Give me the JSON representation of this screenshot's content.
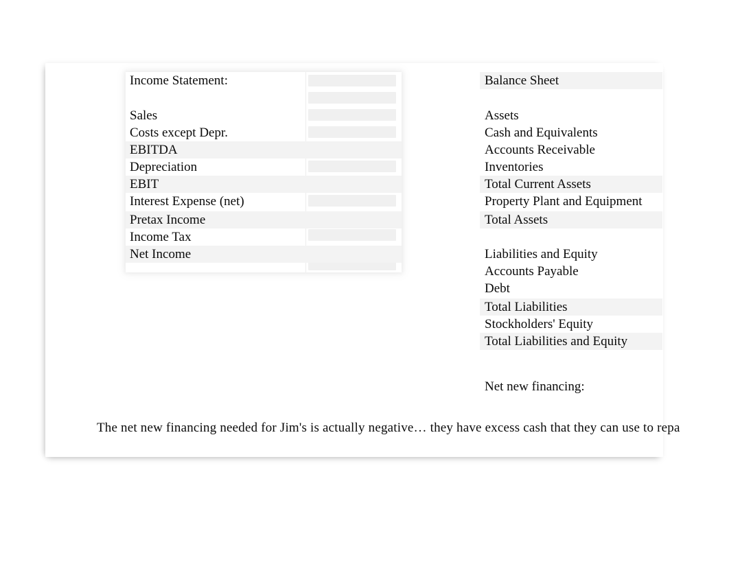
{
  "document": {
    "background_color": "#ffffff",
    "content_area_color": "#ffffff",
    "row_shade_color": "#f3f3f3",
    "text_color": "#0a0a0a"
  },
  "income_statement": {
    "title": "Income Statement:",
    "rows": [
      {
        "label": "Income Statement:",
        "value": "",
        "shaded": false
      },
      {
        "label": "",
        "value": "",
        "shaded": false
      },
      {
        "label": "Sales",
        "value": "",
        "shaded": false
      },
      {
        "label": "Costs except Depr.",
        "value": "",
        "shaded": false
      },
      {
        "label": "EBITDA",
        "value": "",
        "shaded": true
      },
      {
        "label": "Depreciation",
        "value": "",
        "shaded": false
      },
      {
        "label": "EBIT",
        "value": "",
        "shaded": true
      },
      {
        "label": "Interest Expense (net)",
        "value": "",
        "shaded": false
      },
      {
        "label": "Pretax Income",
        "value": "",
        "shaded": true
      },
      {
        "label": "Income Tax",
        "value": "",
        "shaded": false
      },
      {
        "label": "Net Income",
        "value": "",
        "shaded": true
      }
    ]
  },
  "balance_sheet": {
    "title": "Balance Sheet",
    "rows": [
      {
        "label": "Balance Sheet",
        "value": "",
        "shaded": false
      },
      {
        "label": "",
        "value": "",
        "shaded": false
      },
      {
        "label": "Assets",
        "value": "",
        "shaded": false
      },
      {
        "label": "Cash and Equivalents",
        "value": "",
        "shaded": false
      },
      {
        "label": "Accounts Receivable",
        "value": "",
        "shaded": false
      },
      {
        "label": "Inventories",
        "value": "",
        "shaded": false
      },
      {
        "label": "Total Current Assets",
        "value": "",
        "shaded": true
      },
      {
        "label": "Property Plant and Equipment",
        "value": "",
        "shaded": false
      },
      {
        "label": "Total Assets",
        "value": "",
        "shaded": true
      },
      {
        "label": "",
        "value": "",
        "shaded": false
      },
      {
        "label": "Liabilities and Equity",
        "value": "",
        "shaded": false
      },
      {
        "label": "Accounts Payable",
        "value": "",
        "shaded": false
      },
      {
        "label": "Debt",
        "value": "",
        "shaded": false
      },
      {
        "label": "Total Liabilities",
        "value": "",
        "shaded": true
      },
      {
        "label": "Stockholders' Equity",
        "value": "",
        "shaded": false
      },
      {
        "label": "Total Liabilities and Equity",
        "value": "",
        "shaded": true
      }
    ]
  },
  "net_new_financing": {
    "label": "Net new financing:",
    "value": ""
  },
  "commentary": {
    "text": "The net new financing needed for Jim's is actually negative… they have excess cash that they can use to repa"
  }
}
